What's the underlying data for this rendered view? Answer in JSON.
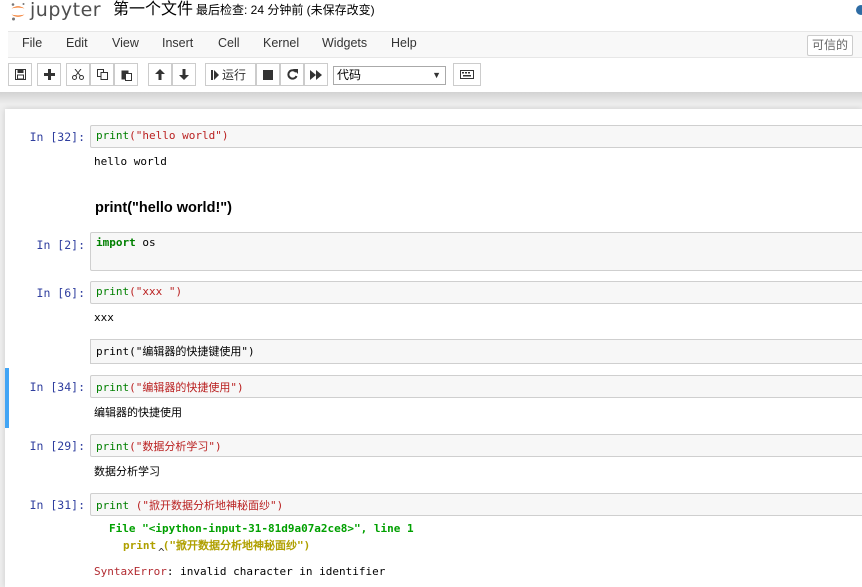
{
  "app": {
    "logo_text": "jupyter",
    "notebook_name": "第一个文件",
    "checkpoint": "最后检查: 24 分钟前  (未保存改变)",
    "trusted": "可信的"
  },
  "menu": [
    "File",
    "Edit",
    "View",
    "Insert",
    "Cell",
    "Kernel",
    "Widgets",
    "Help"
  ],
  "toolbar": {
    "run_label": "运行",
    "cell_type": "代码",
    "icons": [
      "save-icon",
      "plus-icon",
      "cut-icon",
      "copy-icon",
      "paste-icon",
      "arrow-up-icon",
      "arrow-down-icon",
      "step-forward-icon",
      "stop-icon",
      "refresh-icon",
      "fast-forward-icon",
      "keyboard-icon"
    ]
  },
  "cells": [
    {
      "prompt": "In  [32]:",
      "code_fn": "print",
      "code_str": "(\"hello world\")",
      "output": "hello world"
    },
    {
      "markdown_heading": "print(\"hello world!\")"
    },
    {
      "prompt": "In  [2]:",
      "code_kw": "import",
      "code_rest": " os"
    },
    {
      "prompt": "In  [6]:",
      "code_fn": "print",
      "code_str": "(\"xxx \")",
      "output": "xxx"
    },
    {
      "markdown_source": "print(\"编辑器的快捷键使用\")"
    },
    {
      "prompt": "In  [34]:",
      "code_fn": "print",
      "code_str": "(\"编辑器的快捷使用\")",
      "output": "编辑器的快捷使用"
    },
    {
      "prompt": "In  [29]:",
      "code_fn": "print",
      "code_str": "(\"数据分析学习\")",
      "output": "数据分析学习"
    },
    {
      "prompt": "In  [31]:",
      "code_fn": "print",
      "code_rest": " (\"掀开数据分析地神秘面纱\")",
      "tb_file_prefix": "File",
      "tb_file_str": "\"<ipython-input-31-81d9a07a2ce8>\"",
      "tb_line": ", line 1",
      "tb_code": "print (\"掀开数据分析地神秘面纱\")",
      "tb_caret": "^",
      "err_name": "SyntaxError",
      "err_msg": ": invalid character in identifier"
    }
  ]
}
